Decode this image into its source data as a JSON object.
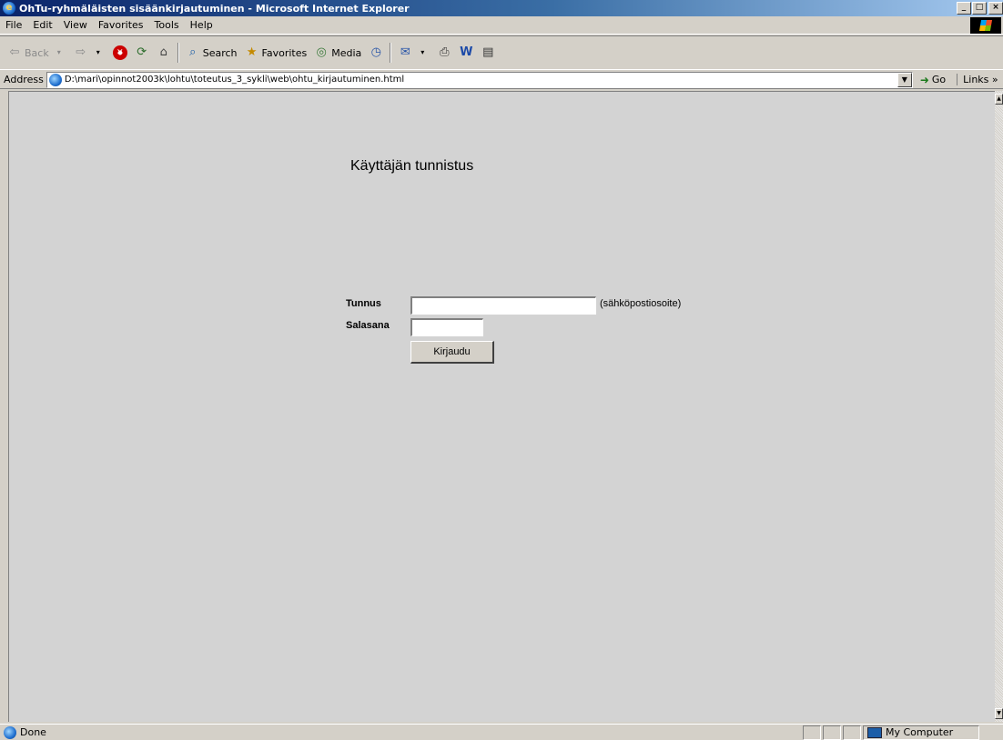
{
  "window": {
    "title": "OhTu-ryhmäläisten sisäänkirjautuminen - Microsoft Internet Explorer",
    "buttons": {
      "minimize": "_",
      "maximize": "□",
      "close": "×"
    }
  },
  "menu": {
    "items": [
      {
        "label": "File"
      },
      {
        "label": "Edit"
      },
      {
        "label": "View"
      },
      {
        "label": "Favorites"
      },
      {
        "label": "Tools"
      },
      {
        "label": "Help"
      }
    ]
  },
  "toolbar": {
    "back": "Back",
    "search": "Search",
    "favorites": "Favorites",
    "media": "Media"
  },
  "address": {
    "label": "Address",
    "url": "D:\\mari\\opinnot2003k\\lohtu\\toteutus_3_sykli\\web\\ohtu_kirjautuminen.html",
    "go": "Go",
    "links": "Links »"
  },
  "page": {
    "heading": "Käyttäjän tunnistus",
    "username_label": "Tunnus",
    "username_value": "",
    "username_hint": "(sähköpostiosoite)",
    "password_label": "Salasana",
    "password_value": "",
    "submit_label": "Kirjaudu",
    "background_color": "#d3d3d3"
  },
  "status": {
    "text": "Done",
    "zone": "My Computer"
  }
}
